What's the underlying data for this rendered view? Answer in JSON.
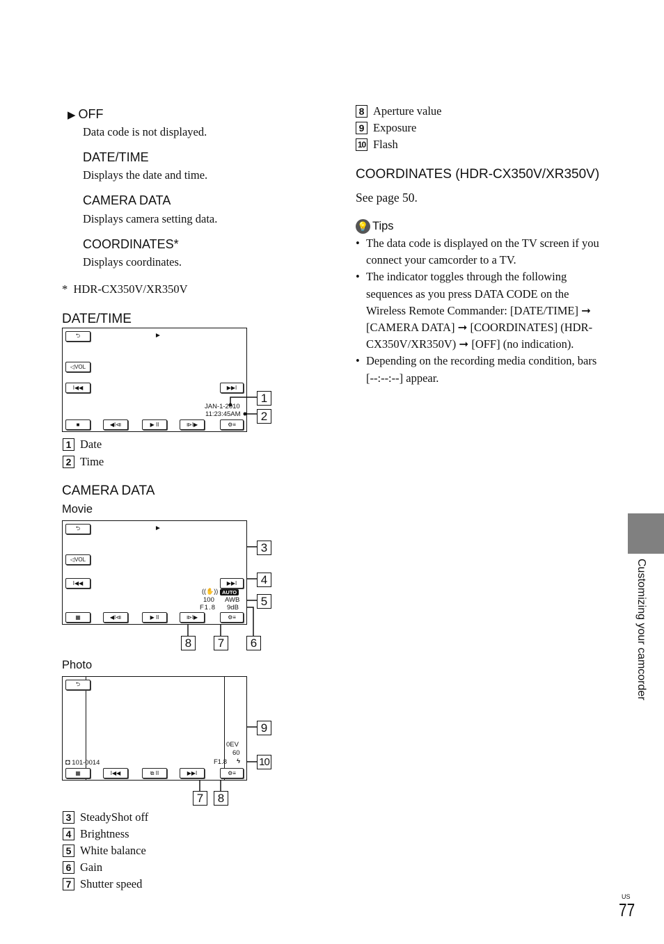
{
  "options": [
    {
      "marker": "▶",
      "title": "OFF",
      "desc": "Data code is not displayed."
    },
    {
      "marker": "",
      "title": "DATE/TIME",
      "desc": "Displays the date and time."
    },
    {
      "marker": "",
      "title": "CAMERA DATA",
      "desc": "Displays camera setting data."
    },
    {
      "marker": "",
      "title": "COORDINATES*",
      "desc": "Displays coordinates."
    }
  ],
  "footnote": "*  HDR-CX350V/XR350V",
  "date_time_section": {
    "heading": "DATE/TIME",
    "screen": {
      "date": "JAN-1-2010",
      "time": "11:23:45AM",
      "vol_label": "VOL"
    },
    "legend": [
      {
        "num": "1",
        "label": "Date"
      },
      {
        "num": "2",
        "label": "Time"
      }
    ]
  },
  "camera_data_section": {
    "heading": "CAMERA DATA",
    "movie": {
      "subheading": "Movie",
      "vol_label": "VOL",
      "brightness": "AUTO",
      "shutter": "100",
      "white_balance": "AWB",
      "aperture": "F1.8",
      "gain": "9dB"
    },
    "photo": {
      "subheading": "Photo",
      "exposure": "0EV",
      "shutter": "60",
      "aperture": "F1.8",
      "file_number": "101-0014"
    },
    "legend": [
      {
        "num": "3",
        "label": "SteadyShot off"
      },
      {
        "num": "4",
        "label": "Brightness"
      },
      {
        "num": "5",
        "label": "White balance"
      },
      {
        "num": "6",
        "label": "Gain"
      },
      {
        "num": "7",
        "label": "Shutter speed"
      },
      {
        "num": "8",
        "label": "Aperture value"
      },
      {
        "num": "9",
        "label": "Exposure"
      },
      {
        "num": "10",
        "label": "Flash"
      }
    ]
  },
  "coordinates_section": {
    "heading": "COORDINATES (HDR-CX350V/XR350V)",
    "text": "See page 50."
  },
  "tips": {
    "heading": "Tips",
    "items": [
      "The data code is displayed on the TV screen if you connect your camcorder to a TV.",
      "The indicator toggles through the following sequences as you press DATA CODE on the Wireless Remote Commander: [DATE/TIME] ➞ [CAMERA DATA] ➞ [COORDINATES] (HDR-CX350V/XR350V) ➞ [OFF] (no indication).",
      "Depending on the recording media condition, bars [--:--:--] appear."
    ]
  },
  "side_tab": {
    "label": "Customizing your camcorder",
    "color": "#808080"
  },
  "page": {
    "region": "US",
    "number": "77"
  }
}
